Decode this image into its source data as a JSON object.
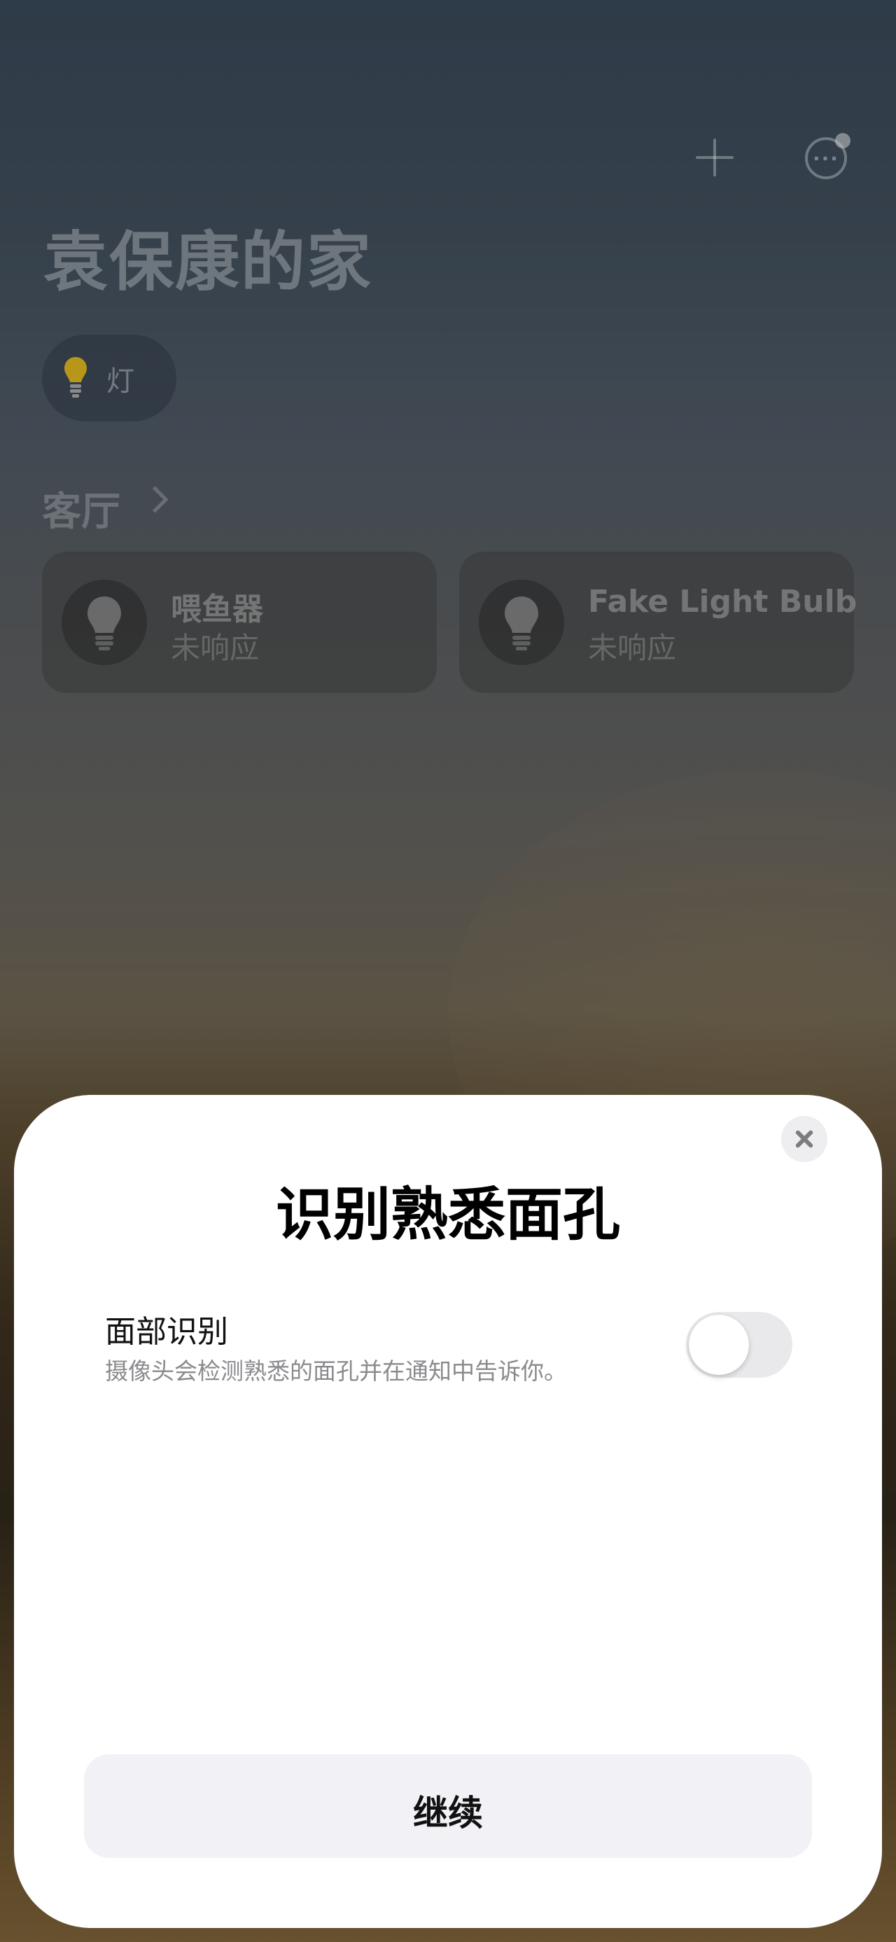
{
  "home": {
    "title": "袁保康的家",
    "add_icon": "plus-icon",
    "more_icon": "ellipsis-circle-icon",
    "category_chip": {
      "label": "灯",
      "icon": "lightbulb-icon",
      "icon_color": "#b8961a"
    },
    "room": {
      "name": "客厅",
      "accessories": [
        {
          "name": "喂鱼器",
          "status": "未响应",
          "icon": "lightbulb-icon"
        },
        {
          "name": "Fake Light Bulb",
          "status": "未响应",
          "icon": "lightbulb-icon"
        }
      ]
    }
  },
  "sheet": {
    "title": "识别熟悉面孔",
    "close_icon": "close-icon",
    "option": {
      "label": "面部识别",
      "description": "摄像头会检测熟悉的面孔并在通知中告诉你。",
      "enabled": false
    },
    "continue_label": "继续"
  }
}
